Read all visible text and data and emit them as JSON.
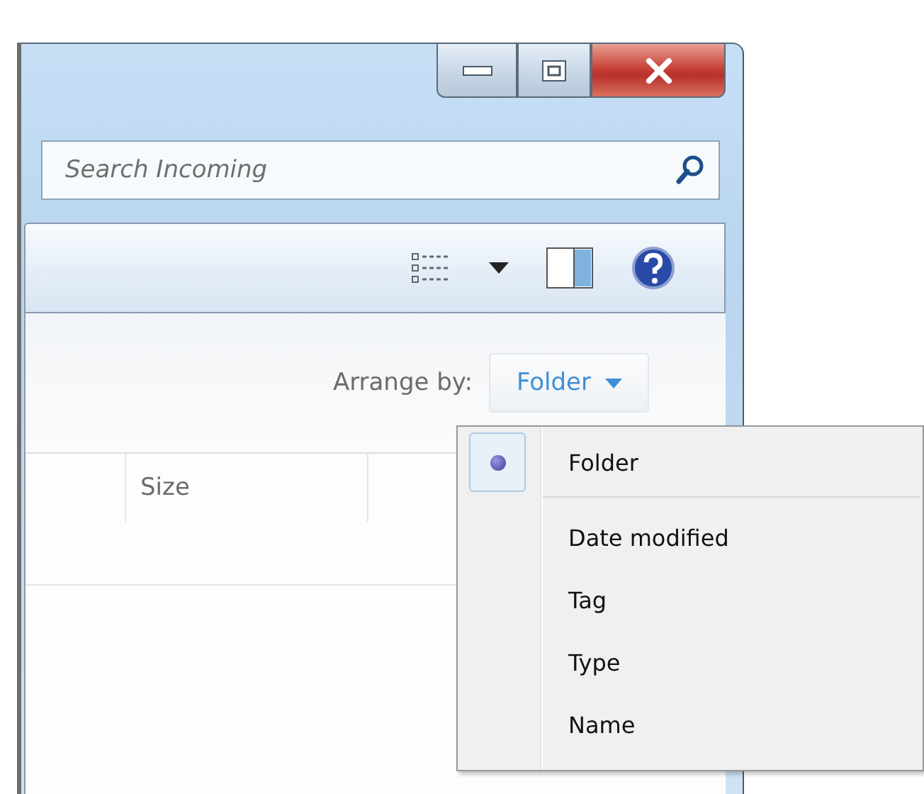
{
  "search": {
    "placeholder": "Search Incoming"
  },
  "arrange": {
    "label": "Arrange by:",
    "value": "Folder"
  },
  "columns": [
    {
      "label": "Size"
    }
  ],
  "arrange_menu": [
    {
      "label": "Folder",
      "selected": true
    },
    {
      "label": "Date modified",
      "selected": false
    },
    {
      "label": "Tag",
      "selected": false
    },
    {
      "label": "Type",
      "selected": false
    },
    {
      "label": "Name",
      "selected": false
    }
  ]
}
